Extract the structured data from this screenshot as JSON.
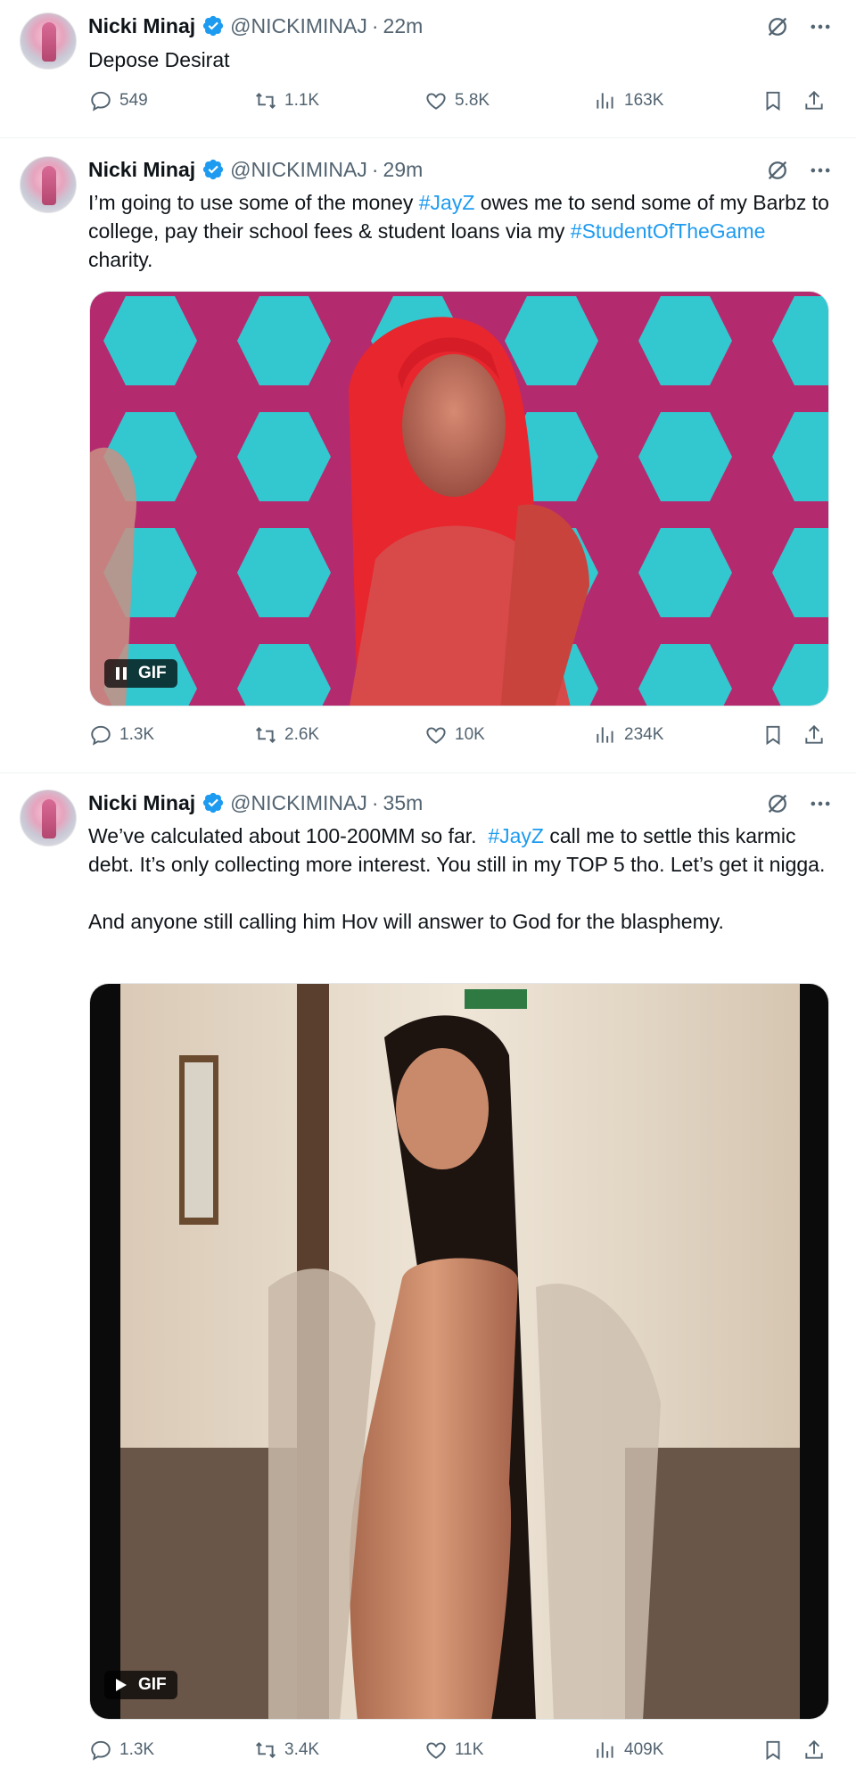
{
  "tweets": [
    {
      "name": "Nicki Minaj",
      "handle": "@NICKIMINAJ",
      "separator": "·",
      "time": "22m",
      "text": [
        {
          "t": "Depose Desirat",
          "tag": false
        }
      ],
      "media": null,
      "replies": "549",
      "reposts": "1.1K",
      "likes": "5.8K",
      "views": "163K"
    },
    {
      "name": "Nicki Minaj",
      "handle": "@NICKIMINAJ",
      "separator": "·",
      "time": "29m",
      "text": [
        {
          "t": "I’m going to use some of the money ",
          "tag": false
        },
        {
          "t": "#JayZ",
          "tag": true
        },
        {
          "t": " owes me to send some of my Barbz to college, pay their school fees & student loans via my ",
          "tag": false
        },
        {
          "t": "#StudentOfTheGame",
          "tag": true
        },
        {
          "t": " charity.",
          "tag": false
        }
      ],
      "media": {
        "type": "gif",
        "badge": "GIF",
        "scene": "red-hair-hexagon-backdrop"
      },
      "replies": "1.3K",
      "reposts": "2.6K",
      "likes": "10K",
      "views": "234K"
    },
    {
      "name": "Nicki Minaj",
      "handle": "@NICKIMINAJ",
      "separator": "·",
      "time": "35m",
      "text": [
        {
          "t": "We’ve calculated about 100-200MM so far.  ",
          "tag": false
        },
        {
          "t": "#JayZ",
          "tag": true
        },
        {
          "t": " call me to settle this karmic debt. It’s only collecting more interest. You still in my TOP 5 tho. Let’s get it nigga.\n\nAnd anyone still calling him Hov will answer to God for the blasphemy.",
          "tag": false
        }
      ],
      "media": {
        "type": "gif",
        "badge": "GIF",
        "scene": "hallway-long-hair"
      },
      "replies": "1.3K",
      "reposts": "3.4K",
      "likes": "11K",
      "views": "409K"
    }
  ],
  "icons": {
    "verified": "verified-badge-icon",
    "grok": "grok-icon",
    "more": "more-icon",
    "reply": "reply-icon",
    "repost": "repost-icon",
    "like": "heart-icon",
    "views": "views-icon",
    "bookmark": "bookmark-icon",
    "share": "share-icon",
    "pause": "pause-icon",
    "play": "play-icon"
  },
  "colors": {
    "accent": "#1d9bf0",
    "muted": "#536471",
    "text": "#0f1419"
  }
}
